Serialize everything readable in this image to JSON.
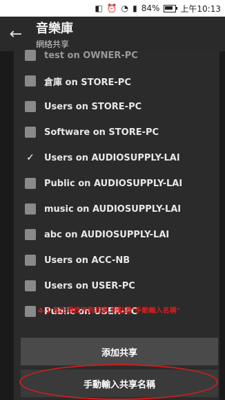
{
  "status_bar": {
    "icons": [
      "nfc-icon",
      "alarm-icon",
      "wifi-icon",
      "signal-icon"
    ],
    "battery": "84%",
    "time": "上午10:13"
  },
  "app_bar": {
    "title": "音樂庫",
    "subtitle": "網絡共享"
  },
  "shares": [
    {
      "label": "test on OWNER-PC",
      "checked": false
    },
    {
      "label": "倉庫 on STORE-PC",
      "checked": false
    },
    {
      "label": "Users on STORE-PC",
      "checked": false
    },
    {
      "label": "Software on STORE-PC",
      "checked": false
    },
    {
      "label": "Users on AUDIOSUPPLY-LAI",
      "checked": true
    },
    {
      "label": "Public on AUDIOSUPPLY-LAI",
      "checked": false
    },
    {
      "label": "music on AUDIOSUPPLY-LAI",
      "checked": false
    },
    {
      "label": "abc on AUDIOSUPPLY-LAI",
      "checked": false
    },
    {
      "label": "Users on ACC-NB",
      "checked": false
    },
    {
      "label": "Users on USER-PC",
      "checked": false
    },
    {
      "label": "Public on USER-PC",
      "checked": false
    }
  ],
  "buttons": {
    "add_share": "添加共享",
    "manual_entry": "手動輸入共享名稱"
  },
  "annotation": "4-1 若出現找不到共享,則點選\"手動輸入名稱\"",
  "colors": {
    "annotation_red": "#d81e1e"
  }
}
